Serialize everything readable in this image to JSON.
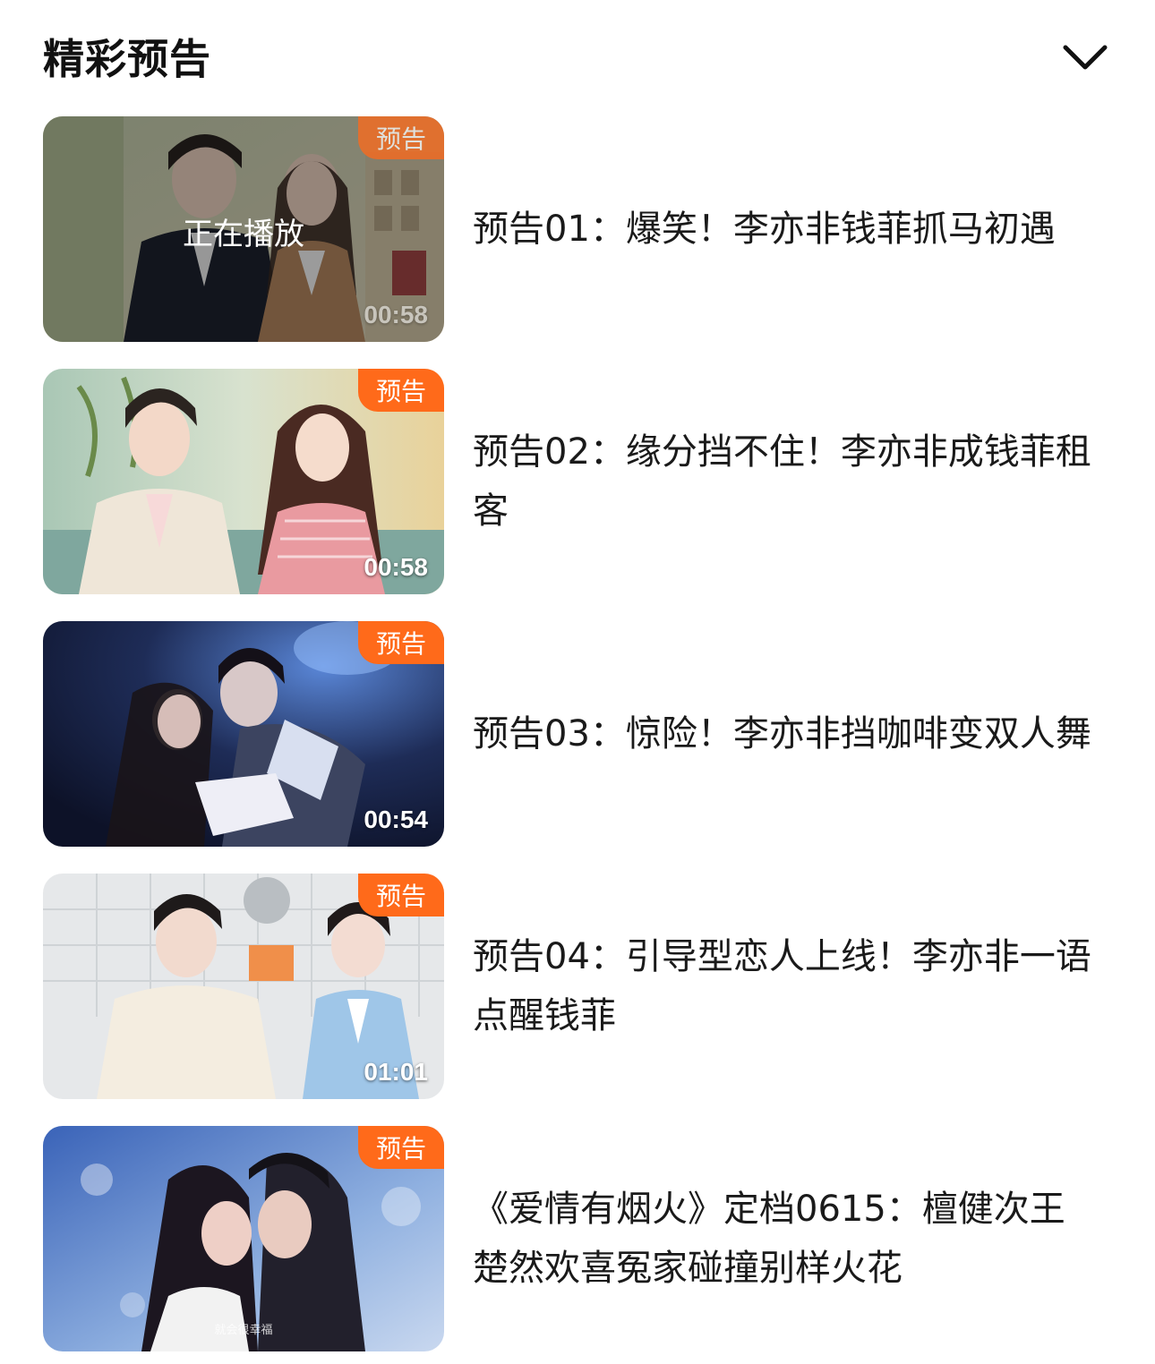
{
  "header": {
    "title": "精彩预告"
  },
  "items": [
    {
      "title": "预告01：爆笑！李亦非钱菲抓马初遇",
      "badge": "预告",
      "duration": "00:58",
      "status": "正在播放"
    },
    {
      "title": "预告02：缘分挡不住！李亦非成钱菲租客",
      "badge": "预告",
      "duration": "00:58"
    },
    {
      "title": "预告03：惊险！李亦非挡咖啡变双人舞",
      "badge": "预告",
      "duration": "00:54"
    },
    {
      "title": "预告04：引导型恋人上线！李亦非一语点醒钱菲",
      "badge": "预告",
      "duration": "01:01"
    },
    {
      "title": "《爱情有烟火》定档0615：檀健次王楚然欢喜冤家碰撞别样火花",
      "badge": "预告",
      "caption": "就会很幸福"
    }
  ],
  "colors": {
    "badge": "#ff6a1a",
    "title_text": "#111111",
    "item_text": "#1a1a1a"
  }
}
